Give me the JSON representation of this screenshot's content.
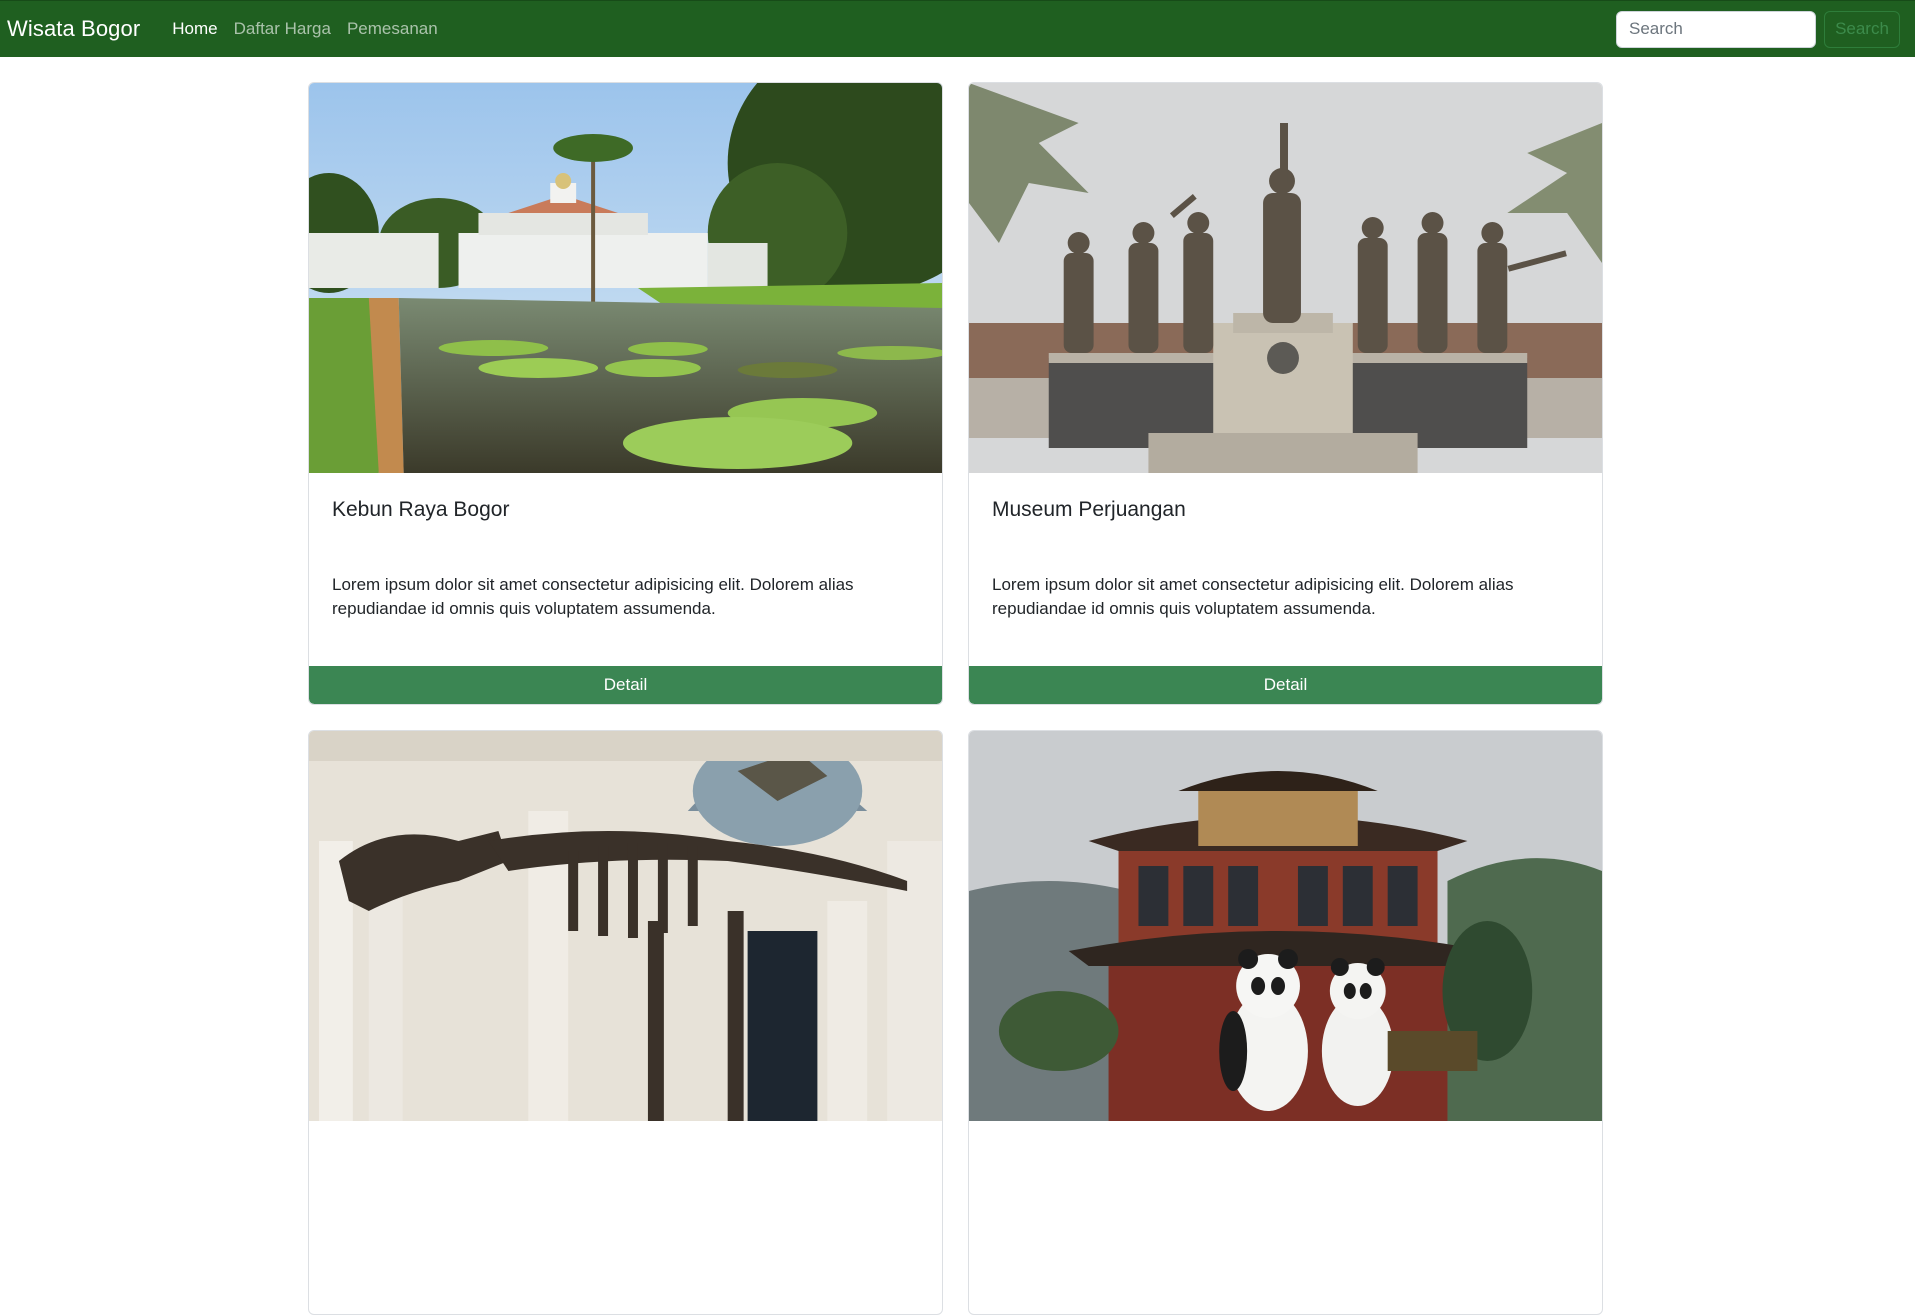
{
  "navbar": {
    "brand": "Wisata Bogor",
    "links": [
      {
        "label": "Home",
        "active": true
      },
      {
        "label": "Daftar Harga",
        "active": false
      },
      {
        "label": "Pemesanan",
        "active": false
      }
    ],
    "search_placeholder": "Search",
    "search_button": "Search",
    "color": "#1f5f20"
  },
  "cards": [
    {
      "title": "Kebun Raya Bogor",
      "text": "Lorem ipsum dolor sit amet consectetur adipisicing elit. Dolorem alias repudiandae id omnis quis voluptatem assumenda.",
      "button": "Detail",
      "image": "botanical-garden-palace-photo"
    },
    {
      "title": "Museum Perjuangan",
      "text": "Lorem ipsum dolor sit amet consectetur adipisicing elit. Dolorem alias repudiandae id omnis quis voluptatem assumenda.",
      "button": "Detail",
      "image": "statue-monument-photo"
    },
    {
      "title": "",
      "text": "",
      "button": "",
      "image": "dinosaur-skeleton-museum-photo"
    },
    {
      "title": "",
      "text": "",
      "button": "",
      "image": "pagoda-panda-statue-photo"
    }
  ],
  "colors": {
    "button": "#3b8653",
    "navbar": "#1f5f20"
  }
}
